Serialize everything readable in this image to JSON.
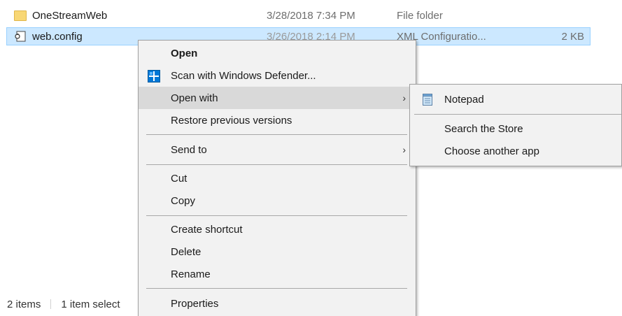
{
  "files": [
    {
      "name": "OneStreamWeb",
      "date": "3/28/2018 7:34 PM",
      "type": "File folder",
      "size": "",
      "icon": "folder-icon"
    },
    {
      "name": "web.config",
      "date": "3/26/2018 2:14 PM",
      "type": "XML Configuratio...",
      "size": "2 KB",
      "icon": "config-file-icon"
    }
  ],
  "status": {
    "count": "2 items",
    "selection": "1 item select"
  },
  "context_menu": {
    "open": "Open",
    "scan": "Scan with Windows Defender...",
    "open_with": "Open with",
    "restore": "Restore previous versions",
    "send_to": "Send to",
    "cut": "Cut",
    "copy": "Copy",
    "create_shortcut": "Create shortcut",
    "delete": "Delete",
    "rename": "Rename",
    "properties": "Properties",
    "arrow": "›"
  },
  "open_with_menu": {
    "notepad": "Notepad",
    "search_store": "Search the Store",
    "choose_app": "Choose another app"
  },
  "colors": {
    "selection": "#cce8ff",
    "menu_bg": "#f2f2f2",
    "defender_blue": "#0078d7"
  }
}
